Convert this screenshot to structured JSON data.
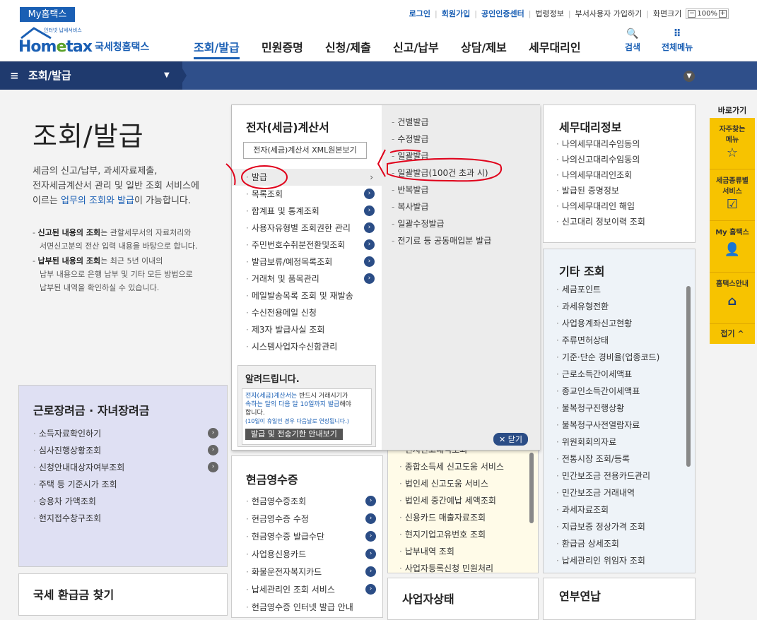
{
  "topbar": {
    "my_hometax": "My홈택스",
    "links": [
      "로그인",
      "회원가입",
      "공인인증센터",
      "법령정보",
      "부서사용자 가입하기",
      "화면크기"
    ],
    "zoom": "100%"
  },
  "header": {
    "logo_text_a": "Hom",
    "logo_text_b": "e",
    "logo_text_c": "tax",
    "logo_name": "국세청홈택스",
    "logo_tagline": "인터넷 납세서비스",
    "nav": [
      "조회/발급",
      "민원증명",
      "신청/제출",
      "신고/납부",
      "상담/제보",
      "세무대리인"
    ],
    "search_label": "검색",
    "allmenu_label": "전체메뉴"
  },
  "breadcrumb": {
    "label": "조회/발급"
  },
  "page": {
    "title": "조회/발급",
    "desc_1": "세금의 신고/납부, 과세자료제출,",
    "desc_2": "전자세금계산서 관리 및 일반 조회 서비스에",
    "desc_3a": "이르는 ",
    "desc_3b": "업무의 조회와 발급",
    "desc_3c": "이 가능합니다.",
    "note1_bold": "신고된 내용의 조회",
    "note1_rest": "는 관할세무서의 자료처리와",
    "note1_line2": "서면신고분의 전산 입력 내용을 바탕으로 합니다.",
    "note2_bold": "납부된 내용의 조회",
    "note2_rest": "는 최근 5년 이내의",
    "note2_line2": "납부 내용으로 은행 납부 및 기타 모든 방법으로",
    "note2_line3": "납부된 내역을 확인하실 수 있습니다."
  },
  "einvoice": {
    "title": "전자(세금)계산서",
    "xml_button": "전자(세금)계산서 XML원본보기",
    "items": [
      "발급",
      "목록조회",
      "합계표 및 통계조회",
      "사용자유형별 조회권한 관리",
      "주민번호수취분전환및조회",
      "발급보류/예정목록조회",
      "거래처 및 품목관리",
      "메일발송목록 조회 및 재발송",
      "수신전용메일 신청",
      "제3자 발급사실 조회",
      "시스템사업자수신함관리"
    ],
    "submenu": [
      "건별발급",
      "수정발급",
      "일괄발급",
      "일괄발급(100건 초과 시)",
      "반복발급",
      "복사발급",
      "일괄수정발급",
      "전기료 등 공동매입분 발급"
    ],
    "notice_title": "알려드립니다.",
    "notice_l1a": "전자(세금)계산서는",
    "notice_l1b": " 반드시 거래시기가",
    "notice_l2a": "속하는 달의 다음 달 10일까지 발급",
    "notice_l2b": "해야",
    "notice_l3": "합니다.",
    "notice_l4": "(10일이 휴일인 경우 다음날로 연장됩니다.)",
    "notice_button": "발급 및 전송기한 안내보기",
    "close_label": "닫기"
  },
  "tax_agent": {
    "title": "세무대리정보",
    "items": [
      "나의세무대리수임동의",
      "나의신고대리수임동의",
      "나의세무대리인조회",
      "발급된 증명정보",
      "나의세무대리인 해임",
      "신고대리 정보이력 조회"
    ]
  },
  "other": {
    "title": "기타 조회",
    "items": [
      "세금포인트",
      "과세유형전환",
      "사업용계좌신고현황",
      "주류면허상태",
      "기준·단순 경비율(업종코드)",
      "근로소득간이세액표",
      "종교인소득간이세액표",
      "불복청구진행상황",
      "불복청구사전열람자료",
      "위원회회의자료",
      "전통시장 조회/등록",
      "민간보조금 전용카드관리",
      "민간보조금 거래내역",
      "과세자료조회",
      "지급보증 정상가격 조회",
      "환급금 상세조회",
      "납세관리인 위임자 조회"
    ]
  },
  "earned": {
    "title": "근로장려금 · 자녀장려금",
    "items": [
      "소득자료확인하기",
      "심사진행상황조회",
      "신청안내대상자여부조회",
      "주택 등 기준시가 조회",
      "승용차 가액조회",
      "현지접수창구조회"
    ]
  },
  "refund": {
    "title": "국세 환급금 찾기"
  },
  "cash": {
    "title": "현금영수증",
    "items": [
      "현금영수증조회",
      "현금영수증 수정",
      "현금영수증 발급수단",
      "사업용신용카드",
      "화물운전자복지카드",
      "납세관리인 조회 서비스",
      "현금영수증 인터넷 발급 안내"
    ]
  },
  "middle": {
    "items": [
      "신지신고내역조회",
      "종합소득세 신고도움 서비스",
      "법인세 신고도움 서비스",
      "법인세 중간예납 세액조회",
      "신용카드 매출자료조회",
      "현지기업고유번호 조회",
      "납부내역 조회",
      "사업자등록신청 민원처리"
    ]
  },
  "biz_status": {
    "title": "사업자상태"
  },
  "yearend": {
    "title": "연부연납"
  },
  "quick": {
    "title": "바로가기",
    "items": [
      {
        "l1": "자주찾는",
        "l2": "메뉴",
        "icon": "☆"
      },
      {
        "l1": "세금종류별",
        "l2": "서비스",
        "icon": "☑"
      },
      {
        "l1": "My 홈택스",
        "l2": "",
        "icon": "👤"
      },
      {
        "l1": "홈택스안내",
        "l2": "",
        "icon": "⌂"
      }
    ],
    "close_label": "접기 ^"
  },
  "colors": {
    "brand": "#1a5fb4",
    "accent": "#f7c300",
    "annotation": "#e0001a"
  }
}
